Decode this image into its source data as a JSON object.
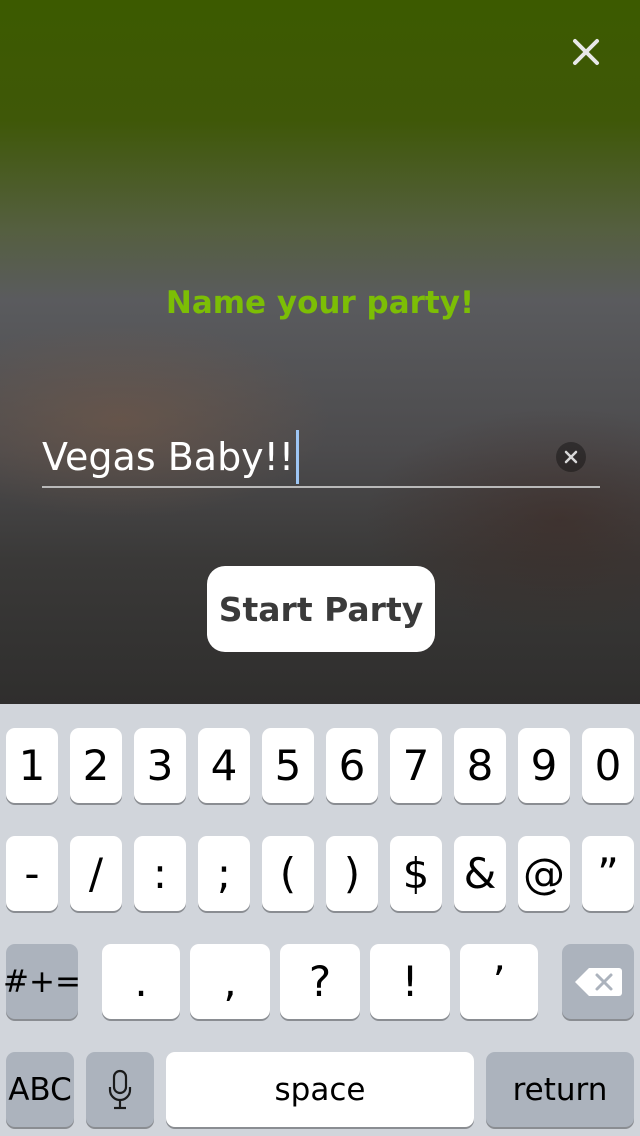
{
  "title": "Name your party!",
  "party_name": {
    "value": "Vegas Baby!!"
  },
  "start_button": "Start Party",
  "keyboard": {
    "row1": [
      "1",
      "2",
      "3",
      "4",
      "5",
      "6",
      "7",
      "8",
      "9",
      "0"
    ],
    "row2": [
      "-",
      "/",
      ":",
      ";",
      "(",
      ")",
      "$",
      "&",
      "@",
      "”"
    ],
    "row3": {
      "toggle": "#+=",
      "keys": [
        ".",
        ",",
        "?",
        "!",
        "’"
      ]
    },
    "row4": {
      "abc": "ABC",
      "space": "space",
      "return": "return"
    }
  },
  "colors": {
    "title": "#7cbe05",
    "keyboard_bg": "#d1d5db",
    "key_fn": "#acb3bd"
  }
}
